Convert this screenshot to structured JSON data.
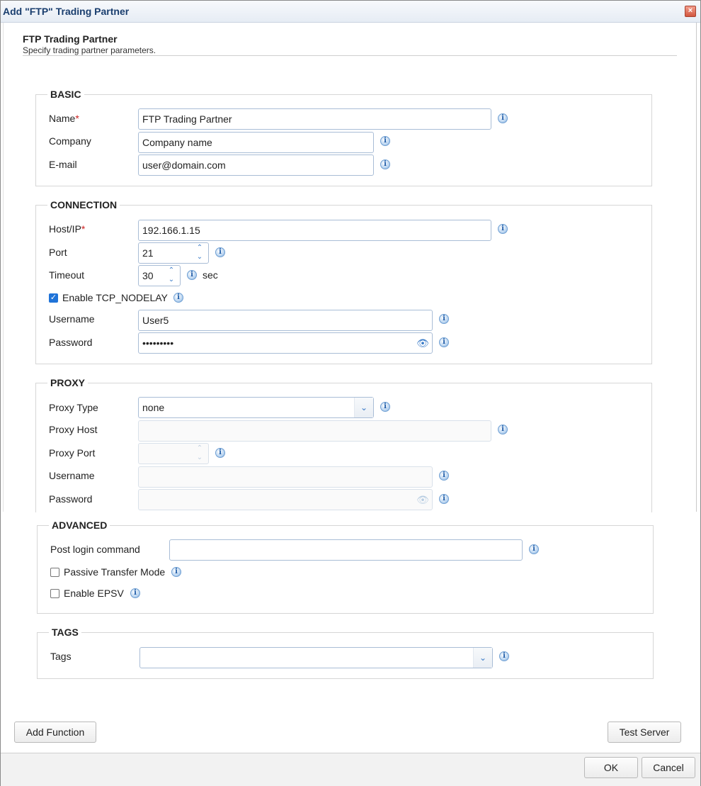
{
  "dialog": {
    "title": "Add \"FTP\" Trading Partner",
    "close_label": "×"
  },
  "header": {
    "title": "FTP Trading Partner",
    "subtitle": "Specify trading partner parameters."
  },
  "basic": {
    "legend": "BASIC",
    "name_label": "Name",
    "name_value": "FTP Trading Partner",
    "company_label": "Company",
    "company_value": "Company name",
    "email_label": "E-mail",
    "email_value": "user@domain.com"
  },
  "connection": {
    "legend": "CONNECTION",
    "host_label": "Host/IP",
    "host_value": "192.166.1.15",
    "port_label": "Port",
    "port_value": "21",
    "timeout_label": "Timeout",
    "timeout_value": "30",
    "timeout_unit": "sec",
    "nodelay_label": "Enable TCP_NODELAY",
    "nodelay_checked": true,
    "username_label": "Username",
    "username_value": "User5",
    "password_label": "Password",
    "password_value": "•••••••••"
  },
  "proxy": {
    "legend": "PROXY",
    "type_label": "Proxy Type",
    "type_value": "none",
    "host_label": "Proxy Host",
    "host_value": "",
    "port_label": "Proxy Port",
    "port_value": "",
    "username_label": "Username",
    "username_value": "",
    "password_label": "Password",
    "password_value": ""
  },
  "advanced": {
    "legend": "ADVANCED",
    "post_login_label": "Post login command",
    "post_login_value": "",
    "passive_label": "Passive Transfer Mode",
    "passive_checked": false,
    "epsv_label": "Enable EPSV",
    "epsv_checked": false
  },
  "tags": {
    "legend": "TAGS",
    "tags_label": "Tags",
    "tags_value": ""
  },
  "buttons": {
    "add_function": "Add Function",
    "test_server": "Test Server",
    "ok": "OK",
    "cancel": "Cancel"
  },
  "icons": {
    "info": "i",
    "eye": "👁",
    "up": "⌃",
    "down": "⌄",
    "check": "✓",
    "chevron": "⌄"
  }
}
